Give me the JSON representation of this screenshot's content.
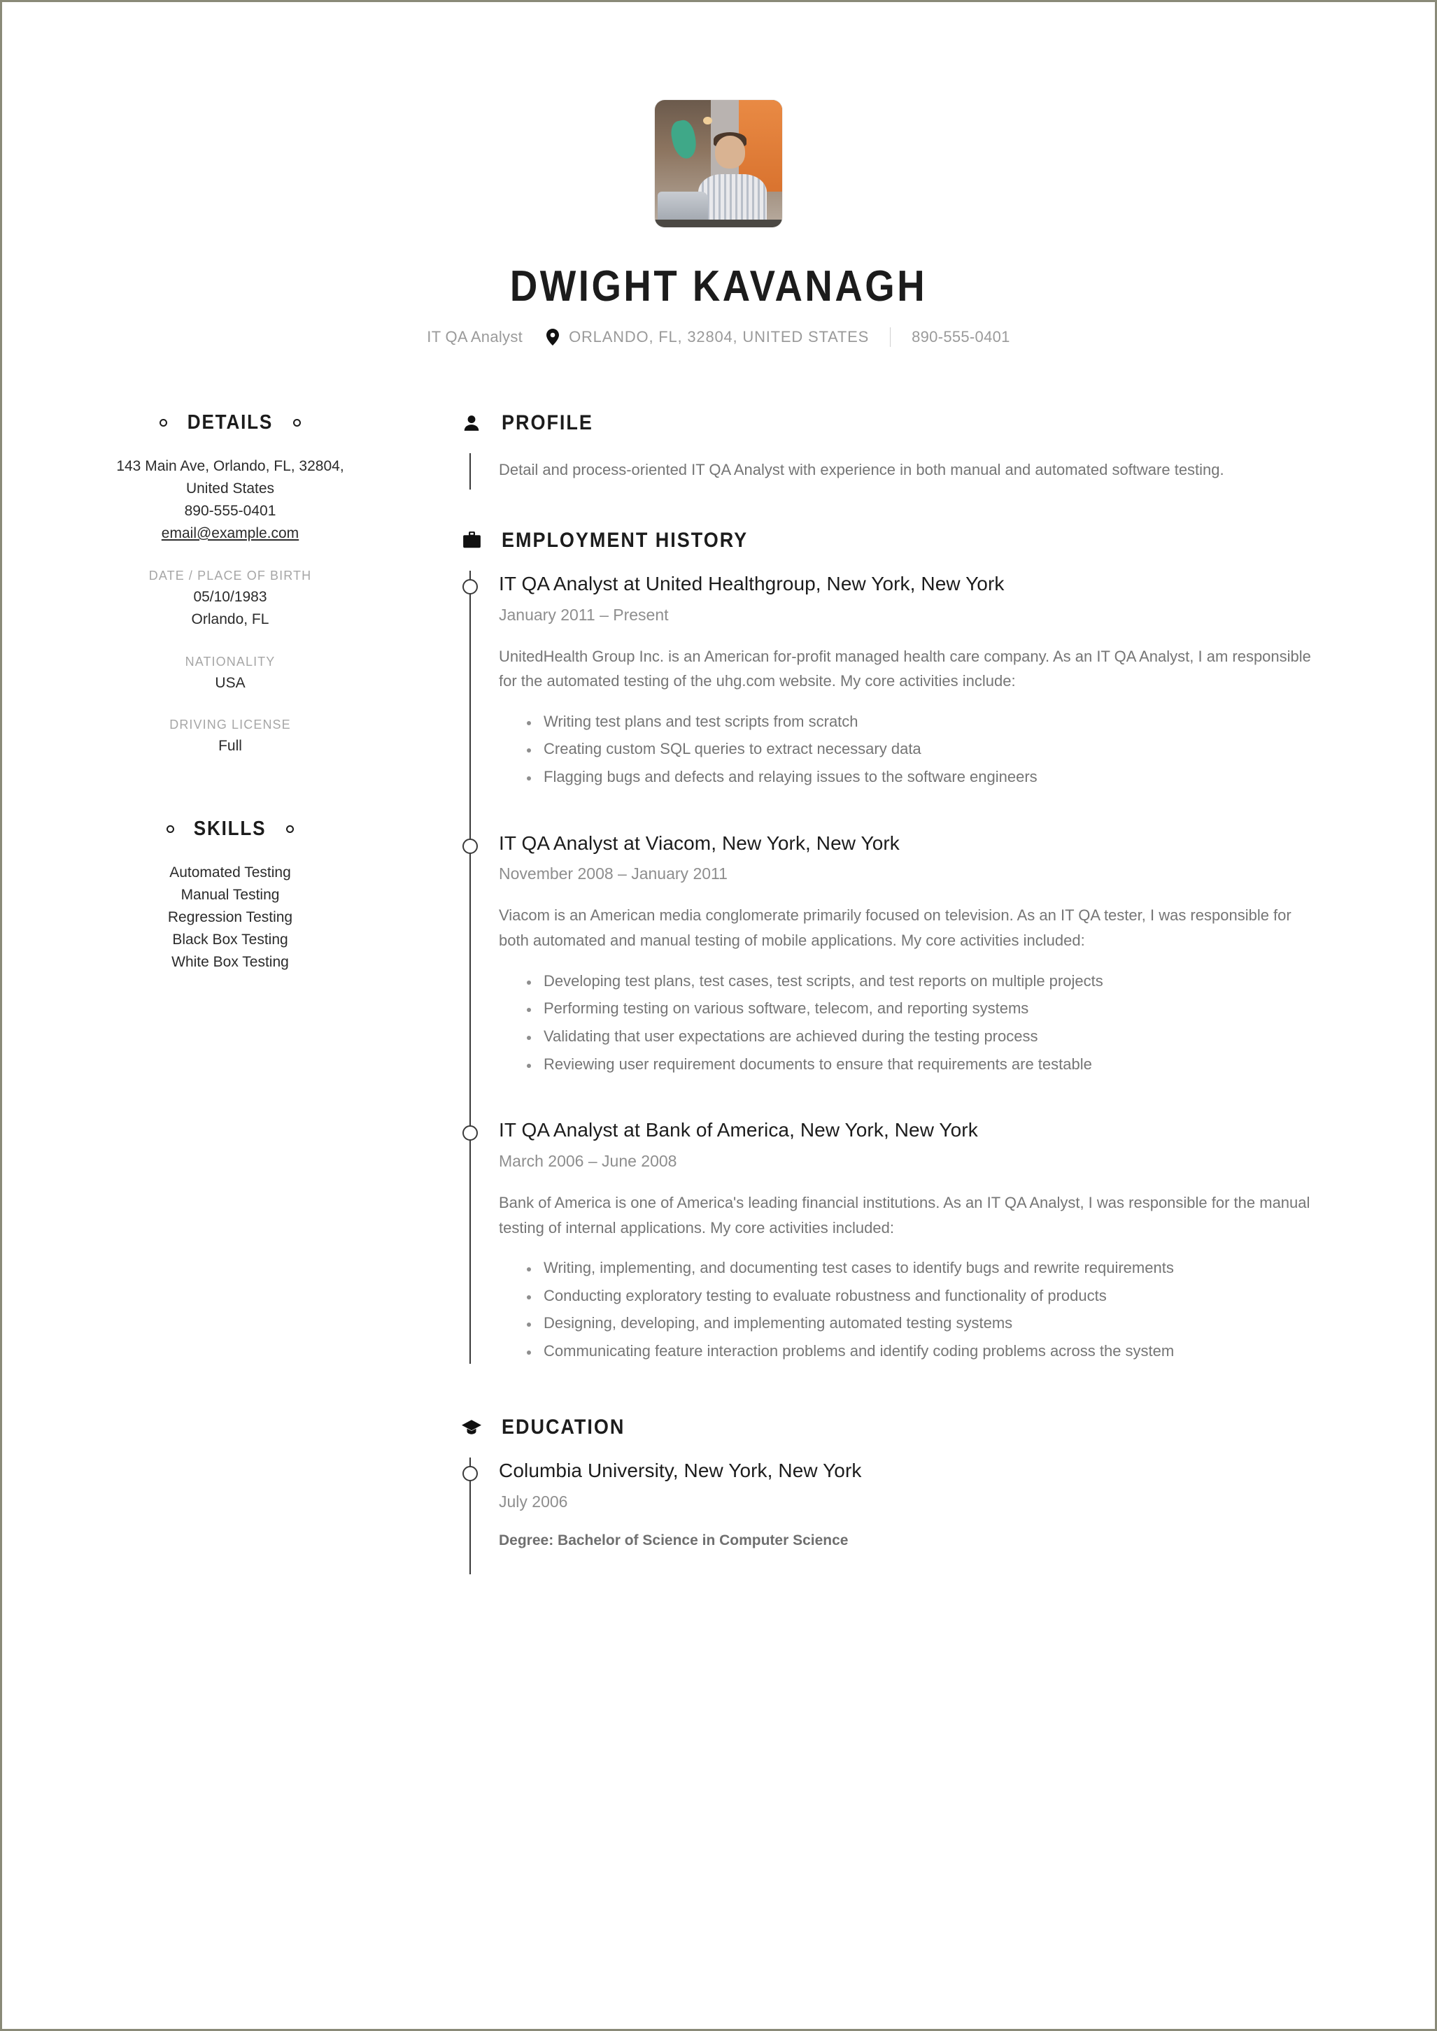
{
  "header": {
    "photo_alt": "profile-photo",
    "name": "DWIGHT KAVANAGH",
    "role": "IT QA Analyst",
    "location_icon": "map-pin-icon",
    "location": "ORLANDO, FL, 32804, UNITED STATES",
    "phone": "890-555-0401"
  },
  "sidebar": {
    "details": {
      "title": "DETAILS",
      "address_line1": "143 Main Ave, Orlando, FL, 32804,",
      "address_line2": "United States",
      "phone": "890-555-0401",
      "email": "email@example.com",
      "groups": [
        {
          "label": "DATE / PLACE OF BIRTH",
          "values": [
            "05/10/1983",
            "Orlando, FL"
          ]
        },
        {
          "label": "NATIONALITY",
          "values": [
            "USA"
          ]
        },
        {
          "label": "DRIVING LICENSE",
          "values": [
            "Full"
          ]
        }
      ]
    },
    "skills": {
      "title": "SKILLS",
      "items": [
        "Automated Testing",
        "Manual Testing",
        "Regression Testing",
        "Black Box Testing",
        "White Box Testing"
      ]
    }
  },
  "main": {
    "profile": {
      "icon": "person-icon",
      "title": "PROFILE",
      "text": "Detail and process-oriented IT QA Analyst with experience in both manual and automated software testing."
    },
    "employment": {
      "icon": "briefcase-icon",
      "title": "EMPLOYMENT HISTORY",
      "entries": [
        {
          "title": "IT QA Analyst at United Healthgroup, New York, New York",
          "dates": "January 2011 – Present",
          "description": "UnitedHealth Group Inc. is an American for-profit managed health care company. As an IT QA Analyst, I am responsible for the automated testing of the uhg.com website. My core activities include:",
          "bullets": [
            "Writing test plans and test scripts from scratch",
            "Creating custom SQL queries to extract necessary data",
            "Flagging bugs and defects and relaying issues to the software engineers"
          ]
        },
        {
          "title": "IT QA Analyst at Viacom, New York, New York",
          "dates": "November 2008 – January 2011",
          "description": "Viacom is an American media conglomerate primarily focused on television. As an IT QA tester, I was responsible for both automated and manual testing of mobile applications. My core activities included:",
          "bullets": [
            "Developing test plans, test cases, test scripts, and test reports on multiple projects",
            "Performing testing on various software, telecom, and reporting systems",
            "Validating that user expectations are achieved during the testing process",
            "Reviewing user requirement documents to ensure that requirements are testable"
          ]
        },
        {
          "title": "IT QA Analyst at Bank of America, New York, New York",
          "dates": "March 2006 – June 2008",
          "description": "Bank of America is one of America's leading financial institutions. As an IT QA Analyst, I was responsible for the manual testing of internal applications. My core activities included:",
          "bullets": [
            "Writing, implementing, and documenting test cases to identify bugs and rewrite requirements",
            "Conducting exploratory testing to evaluate robustness and functionality of products",
            "Designing, developing, and implementing automated testing systems",
            "Communicating feature interaction problems and identify coding problems across the system"
          ]
        }
      ]
    },
    "education": {
      "icon": "graduation-cap-icon",
      "title": "EDUCATION",
      "entries": [
        {
          "title": "Columbia University, New York, New York",
          "dates": "July 2006",
          "degree": "Degree: Bachelor of Science in Computer Science"
        }
      ]
    }
  },
  "colors": {
    "text_dark": "#1c1c1c",
    "text_muted": "#757575",
    "text_light": "#a6a6a6",
    "rule": "#3a3a3a",
    "page_border": "#8a8a78"
  }
}
